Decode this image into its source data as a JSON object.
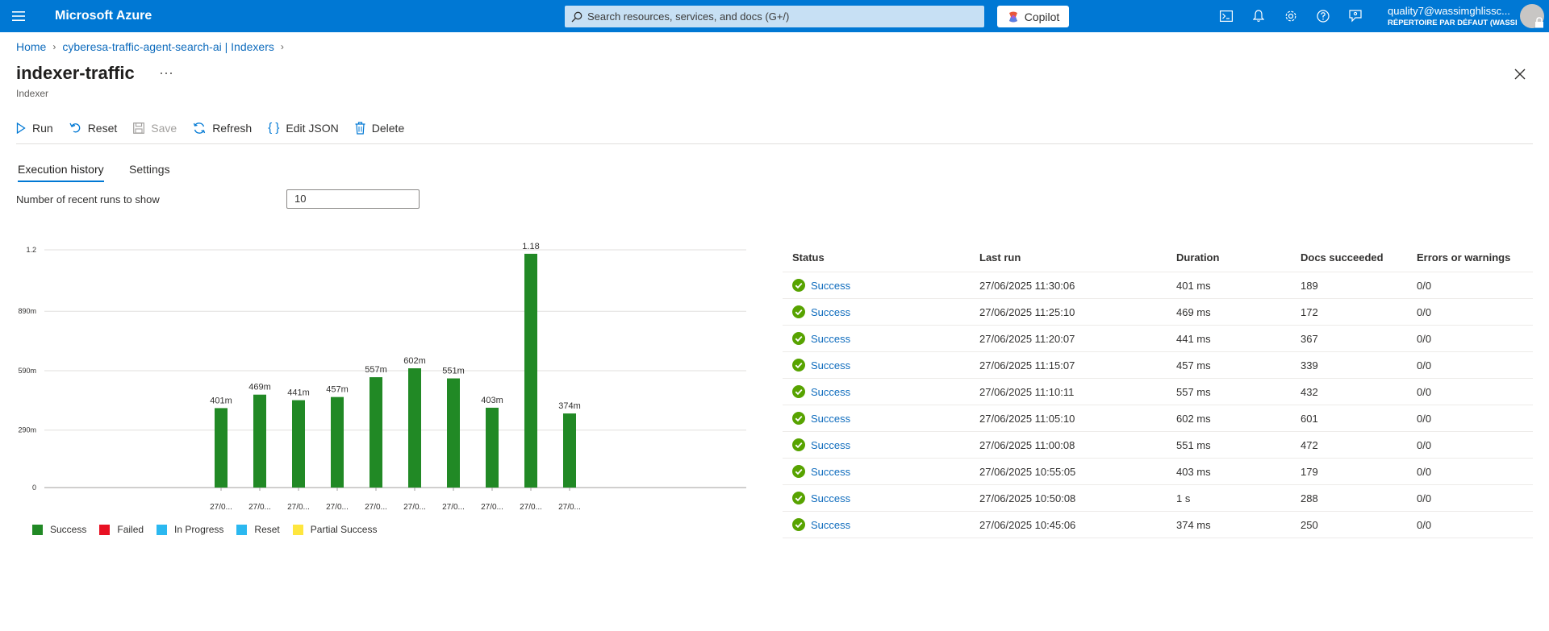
{
  "topbar": {
    "brand": "Microsoft Azure",
    "search_placeholder": "Search resources, services, and docs (G+/)",
    "copilot_label": "Copilot",
    "account_email": "quality7@wassimghlissc...",
    "account_directory": "RÉPERTOIRE PAR DÉFAUT (WASSI..."
  },
  "breadcrumb": {
    "home": "Home",
    "resource": "cyberesa-traffic-agent-search-ai | Indexers"
  },
  "page": {
    "title": "indexer-traffic",
    "ellipsis": "···",
    "subtitle": "Indexer"
  },
  "toolbar": {
    "run": "Run",
    "reset": "Reset",
    "save": "Save",
    "refresh": "Refresh",
    "edit_json": "Edit JSON",
    "delete": "Delete"
  },
  "tabs": {
    "history": "Execution history",
    "settings": "Settings"
  },
  "runs": {
    "label": "Number of recent runs to show",
    "value": "10"
  },
  "colors": {
    "accent": "#0078d4",
    "success": "#218925",
    "failed": "#e81123",
    "in_progress": "#2bb8f0",
    "reset": "#2bb8f0",
    "partial": "#fee63e"
  },
  "chart_data": {
    "type": "bar",
    "categories": [
      "27/0...",
      "27/0...",
      "27/0...",
      "27/0...",
      "27/0...",
      "27/0...",
      "27/0...",
      "27/0...",
      "27/0...",
      "27/0..."
    ],
    "values": [
      0.401,
      0.469,
      0.441,
      0.457,
      0.557,
      0.602,
      0.551,
      0.403,
      1.18,
      0.374
    ],
    "data_labels": [
      "401m",
      "469m",
      "441m",
      "457m",
      "557m",
      "602m",
      "551m",
      "403m",
      "1.18",
      "374m"
    ],
    "y_ticks": [
      0,
      0.29,
      0.59,
      0.89,
      1.2
    ],
    "y_tick_labels": [
      "0",
      "290m",
      "590m",
      "890m",
      "1.2"
    ],
    "ylim": [
      0,
      1.2
    ],
    "grid": true,
    "legend_position": "bottom-left",
    "legend": [
      "Success",
      "Failed",
      "In Progress",
      "Reset",
      "Partial Success"
    ]
  },
  "table": {
    "headers": [
      "Status",
      "Last run",
      "Duration",
      "Docs succeeded",
      "Errors or warnings"
    ],
    "rows": [
      {
        "status": "Success",
        "last_run": "27/06/2025 11:30:06",
        "duration": "401 ms",
        "docs": "189",
        "errors": "0/0"
      },
      {
        "status": "Success",
        "last_run": "27/06/2025 11:25:10",
        "duration": "469 ms",
        "docs": "172",
        "errors": "0/0"
      },
      {
        "status": "Success",
        "last_run": "27/06/2025 11:20:07",
        "duration": "441 ms",
        "docs": "367",
        "errors": "0/0"
      },
      {
        "status": "Success",
        "last_run": "27/06/2025 11:15:07",
        "duration": "457 ms",
        "docs": "339",
        "errors": "0/0"
      },
      {
        "status": "Success",
        "last_run": "27/06/2025 11:10:11",
        "duration": "557 ms",
        "docs": "432",
        "errors": "0/0"
      },
      {
        "status": "Success",
        "last_run": "27/06/2025 11:05:10",
        "duration": "602 ms",
        "docs": "601",
        "errors": "0/0"
      },
      {
        "status": "Success",
        "last_run": "27/06/2025 11:00:08",
        "duration": "551 ms",
        "docs": "472",
        "errors": "0/0"
      },
      {
        "status": "Success",
        "last_run": "27/06/2025 10:55:05",
        "duration": "403 ms",
        "docs": "179",
        "errors": "0/0"
      },
      {
        "status": "Success",
        "last_run": "27/06/2025 10:50:08",
        "duration": "1 s",
        "docs": "288",
        "errors": "0/0"
      },
      {
        "status": "Success",
        "last_run": "27/06/2025 10:45:06",
        "duration": "374 ms",
        "docs": "250",
        "errors": "0/0"
      }
    ]
  }
}
